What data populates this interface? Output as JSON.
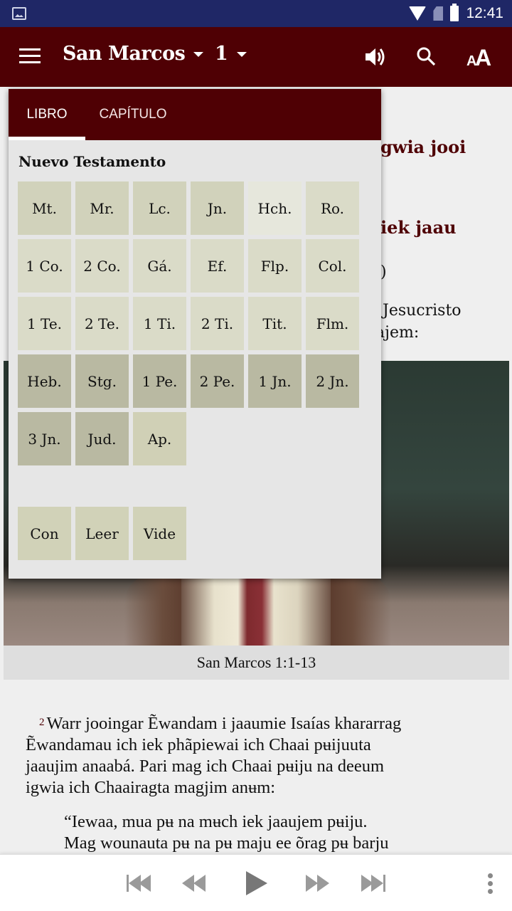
{
  "status_bar": {
    "time": "12:41",
    "icons": [
      "gallery-icon",
      "wifi-icon",
      "no-sim-icon",
      "battery-icon"
    ]
  },
  "app_bar": {
    "book": "San Marcos",
    "chapter": "1",
    "icons": [
      "menu-icon",
      "speaker-icon",
      "search-icon",
      "text-size-icon"
    ]
  },
  "background_text": {
    "title_fragment_1": "gwia jooi",
    "title_fragment_2": "iek jaau",
    "fragment_paren": ")",
    "line_1": "Jesucristo",
    "line_2": "ajem:"
  },
  "image_caption": "San Marcos 1:1-13",
  "verse": {
    "number": "2",
    "lines": [
      "Warr jooingar Ẽwandam i jaaumie Isaías khararrag",
      "Ẽwandamau ich iek phãpiewai ich Chaai pʉijuuta",
      "jaaujim anaabá. Pari mag ich Chaai pʉiju na deeum",
      "igwia ich Chaairagta magjim anʉm:"
    ]
  },
  "quote_lines": [
    "“Iewaa, mua pʉ na mʉch iek jaaujem pʉiju.",
    "Mag wounauta pʉ na pʉ maju ee õrag pʉ barju"
  ],
  "popup": {
    "tabs": [
      {
        "label": "LIBRO",
        "active": true
      },
      {
        "label": "CAPÍTULO",
        "active": false
      }
    ],
    "section_title": "Nuevo Testamento",
    "books": [
      {
        "label": "Mt.",
        "color": "#d1d2bb"
      },
      {
        "label": "Mr.",
        "color": "#d1d2bb"
      },
      {
        "label": "Lc.",
        "color": "#d1d2bb"
      },
      {
        "label": "Jn.",
        "color": "#d1d2bb"
      },
      {
        "label": "Hch.",
        "color": "#e6e7dc"
      },
      {
        "label": "Ro.",
        "color": "#dadbc8"
      },
      {
        "label": "1 Co.",
        "color": "#dadbc8"
      },
      {
        "label": "2 Co.",
        "color": "#dadbc8"
      },
      {
        "label": "Gá.",
        "color": "#dadbc8"
      },
      {
        "label": "Ef.",
        "color": "#dadbc8"
      },
      {
        "label": "Flp.",
        "color": "#dadbc8"
      },
      {
        "label": "Col.",
        "color": "#dadbc8"
      },
      {
        "label": "1 Te.",
        "color": "#dadbc8"
      },
      {
        "label": "2 Te.",
        "color": "#dadbc8"
      },
      {
        "label": "1 Ti.",
        "color": "#dadbc8"
      },
      {
        "label": "2 Ti.",
        "color": "#dadbc8"
      },
      {
        "label": "Tit.",
        "color": "#dadbc8"
      },
      {
        "label": "Flm.",
        "color": "#dadbc8"
      },
      {
        "label": "Heb.",
        "color": "#b9b9a2"
      },
      {
        "label": "Stg.",
        "color": "#b9b9a2"
      },
      {
        "label": "1 Pe.",
        "color": "#b9b9a2"
      },
      {
        "label": "2 Pe.",
        "color": "#b9b9a2"
      },
      {
        "label": "1 Jn.",
        "color": "#b9b9a2"
      },
      {
        "label": "2 Jn.",
        "color": "#b9b9a2"
      },
      {
        "label": "3 Jn.",
        "color": "#b9b9a2"
      },
      {
        "label": "Jud.",
        "color": "#b9b9a2"
      },
      {
        "label": "Ap.",
        "color": "#d0d0b6"
      }
    ],
    "extras": [
      {
        "label": "Con",
        "color": "#d1d2b8"
      },
      {
        "label": "Leer",
        "color": "#d1d2b8"
      },
      {
        "label": "Vide",
        "color": "#d1d2b8"
      }
    ]
  },
  "player": {
    "controls": [
      "skip-previous-icon",
      "rewind-icon",
      "play-icon",
      "fast-forward-icon",
      "skip-next-icon",
      "more-vert-icon"
    ]
  },
  "colors": {
    "status_bar": "#1f2766",
    "app_bar": "#4f0004",
    "accent": "#4f0004",
    "popup_bg": "#e6e6e6",
    "page_bg": "#efefef"
  }
}
